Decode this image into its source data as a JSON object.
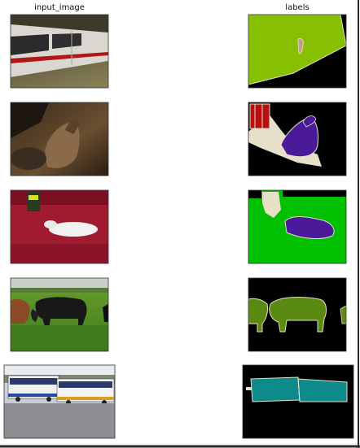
{
  "titles": {
    "left": "input_image",
    "right": "labels"
  },
  "colors": {
    "background": "#ffffff",
    "mask_background": "#000000",
    "train_green": "#86c000",
    "train_pink": "#c89a8a",
    "mask_outline": "#e6e0c8",
    "dog_purple": "#4b1a9a",
    "person_red": "#b81010",
    "sofa_green": "#00c000",
    "cow_green": "#5a8a12",
    "bus_teal": "#0e8a8a"
  },
  "rows": [
    {
      "input": "train-photo",
      "label": "train-mask"
    },
    {
      "input": "dog-photo",
      "label": "dog-mask"
    },
    {
      "input": "cat-on-sofa-photo",
      "label": "cat-sofa-mask"
    },
    {
      "input": "cows-photo",
      "label": "cows-mask"
    },
    {
      "input": "buses-photo",
      "label": "bus-mask"
    }
  ]
}
